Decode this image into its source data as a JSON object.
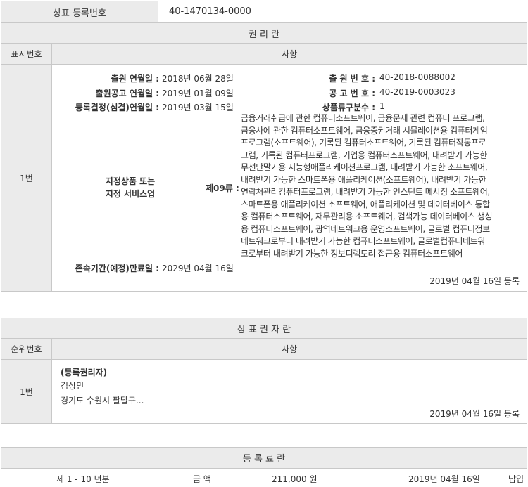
{
  "reg": {
    "label": "상표 등록번호",
    "number": "40-1470134-0000"
  },
  "rights": {
    "title": "권 리 란",
    "col_no": "표시번호",
    "col_item": "사항",
    "row_no": "1번",
    "app_date_label": "출원 연월일 :",
    "app_date": "2018년 06월 28일",
    "pub_date_label": "출원공고 연월일 :",
    "pub_date": "2019년 01월 09일",
    "reg_date_label": "등록결정(심결)연월일 :",
    "reg_date": "2019년 03월 15일",
    "app_no_label": "출 원 번 호 :",
    "app_no": "40-2018-0088002",
    "pub_no_label": "공 고 번 호 :",
    "pub_no": "40-2019-0003023",
    "class_count_label": "상품류구분수 :",
    "class_count": "1",
    "goods_label_line1": "지정상품 또는",
    "goods_label_line2": "지정 서비스업",
    "class_label": "제09류 :",
    "goods_lines": [
      "금융거래취급에 관한 컴퓨터소프트웨어, 금융문제 관련 컴퓨터 프로그램,",
      "금융사에 관한 컴퓨터소프트웨어, 금융증권거래 시뮬레이션용 컴퓨터게임",
      "프로그램(소프트웨어), 기록된 컴퓨터소프트웨어, 기록된 컴퓨터작동프로",
      "그램, 기록된 컴퓨터프로그램, 기업용 컴퓨터소프트웨어, 내려받기 가능한",
      "무선단말기용 지능형애플리케이션프로그램, 내려받기 가능한 소프트웨어,",
      "내려받기 가능한 스마트폰용 애플리케이션(소프트웨어), 내려받기 가능한",
      "연락처관리컴퓨터프로그램, 내려받기 가능한 인스턴트 메시징 소프트웨어,",
      "스마트폰용 애플리케이션 소프트웨어, 애플리케이션 및 데이터베이스 통합",
      "용 컴퓨터소프트웨어, 재무관리용 소프트웨어, 검색가능 데이터베이스 생성",
      "용 컴퓨터소프트웨어, 광역네트워크용 운영소프트웨어, 글로벌 컴퓨터정보",
      "네트워크로부터 내려받기 가능한 컴퓨터소프트웨어, 글로벌컴퓨터네트워",
      "크로부터 내려받기 가능한 정보디렉토리 접근용 컴퓨터소프트웨어"
    ],
    "expiry_label": "존속기간(예정)만료일 :",
    "expiry": "2029년 04월 16일",
    "footer": "2019년 04월 16일 등록"
  },
  "owner": {
    "title": "상 표 권 자 란",
    "col_no": "순위번호",
    "col_item": "사항",
    "row_no": "1번",
    "type": "(등록권리자)",
    "name": "김상민",
    "address": "경기도 수원시 팔달구...",
    "footer": "2019년 04월 16일 등록"
  },
  "fee": {
    "title": "등 록 료 란",
    "period": "제 1 - 10 년분",
    "amount_label": "금 액",
    "amount": "211,000 원",
    "date": "2019년 04월 16일",
    "status": "납입"
  },
  "colors": {
    "header_bg": "#ebebeb",
    "border": "#c8c8c8",
    "text": "#333333"
  }
}
